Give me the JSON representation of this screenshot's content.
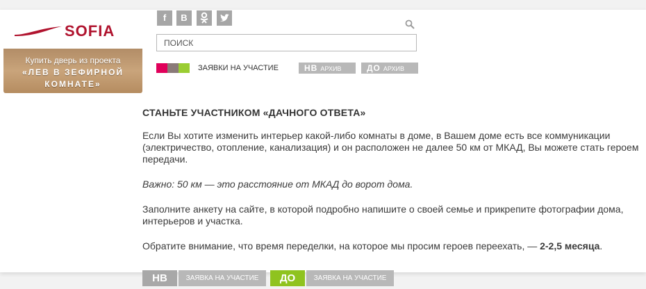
{
  "ad": {
    "brand": "SOFIA",
    "line1": "Купить дверь из проекта",
    "line2": "«ЛЕВ В ЗЕФИРНОЙ",
    "line3": "КОМНАТЕ»"
  },
  "social": [
    "f",
    "В",
    "ok-icon",
    "twitter-icon"
  ],
  "search": {
    "placeholder": "ПОИСК"
  },
  "header": {
    "apply_label": "ЗАЯВКИ НА УЧАСТИЕ",
    "archive1_logo": "НВ",
    "archive1_label": "АРХИВ",
    "archive2_logo": "ДО",
    "archive2_label": "АРХИВ",
    "swatch_colors": [
      "#e0005a",
      "#8a7a78",
      "#9acd32"
    ]
  },
  "content": {
    "title": "СТАНЬТЕ УЧАСТНИКОМ «ДАЧНОГО ОТВЕТА»",
    "p1": "Если Вы хотите изменить интерьер какой-либо комнаты в доме, в Вашем доме есть все коммуникации (электричество, отопление, канализация) и он расположен не далее 50 км от МКАД, Вы можете стать героем передачи.",
    "p2": "Важно: 50 км — это расстояние от МКАД до ворот дома.",
    "p3": "Заполните анкету на сайте, в которой подробно напишите о своей семье и прикрепите фотографии дома, интерьеров и участка.",
    "p4_text": "Обратите внимание, что время переделки, на которое мы просим героев переехать, — ",
    "p4_bold": "2-2,5 месяца",
    "p4_end": "."
  },
  "bottom": {
    "nv_logo": "НВ",
    "nv_label": "ЗАЯВКА НА УЧАСТИЕ",
    "do_logo": "ДО",
    "do_label": "ЗАЯВКА НА УЧАСТИЕ",
    "nv_color": "#b8b8b8",
    "do_color": "#8fc31f"
  }
}
